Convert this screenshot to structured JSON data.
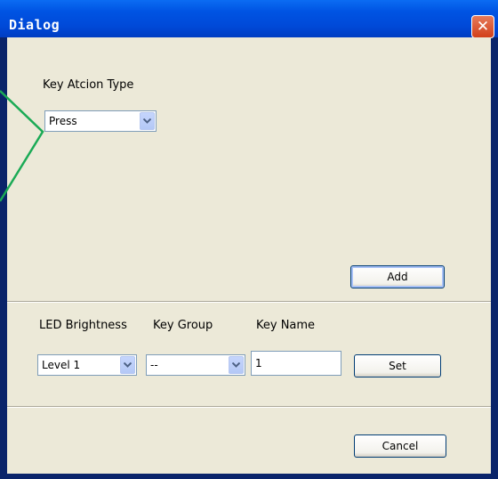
{
  "window": {
    "title": "Dialog",
    "close_glyph": "✕"
  },
  "key_action": {
    "label": "Key Atcion Type",
    "selected": "Press"
  },
  "add_button": "Add",
  "row_labels": {
    "led": "LED Brightness",
    "group": "Key Group",
    "name": "Key Name"
  },
  "led_select": {
    "selected": "Level 1"
  },
  "group_select": {
    "selected": "--"
  },
  "name_input": {
    "value": "1"
  },
  "set_button": "Set",
  "cancel_button": "Cancel",
  "colors": {
    "titlebar": "#0054e3",
    "dialog_bg": "#ece9d8",
    "annotation": "#1aaa55"
  }
}
